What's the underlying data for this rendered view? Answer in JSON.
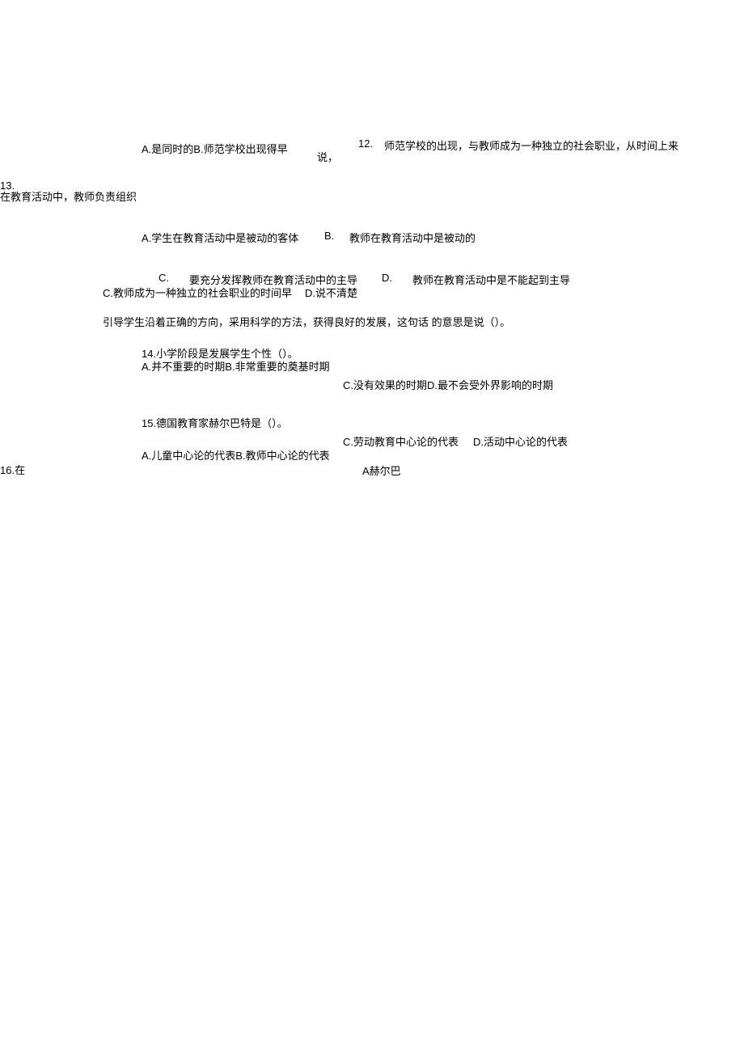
{
  "t1": "A.是同时的B.师范学校出现得早",
  "t2": "说，",
  "t3": "12.",
  "t4": "师范学校的出现，与教师成为一种独立的社会职业，从时间上来",
  "t5": "13.",
  "t6": "在教育活动中，教师负责组织",
  "t7": "A.学生在教育活动中是被动的客体",
  "t8": "B.",
  "t9": "教师在教育活动中是被动的",
  "t10": "C.",
  "t11": "要充分发挥教师在教育活动中的主导",
  "t12": "D.",
  "t13": "教师在教育活动中是不能起到主导",
  "t14": "C.教师成为一种独立的社会职业的时间早",
  "t15": "D.说不清楚",
  "t16": "引导学生沿着正确的方向，采用科学的方法，获得良好的发展，这句话 的意思是说（）。",
  "t17": "14.小学阶段是发展学生个性（）。",
  "t18": "A.并不重要的时期B.非常重要的奠基时期",
  "t19": "C.没有效果的时期D.最不会受外界影响的时期",
  "t20": "15.德国教育家赫尔巴特是（）。",
  "t21": "C.劳动教育中心论的代表",
  "t22": "D.活动中心论的代表",
  "t23": "A.儿童中心论的代表B.教师中心论的代表",
  "t24": "A赫尔巴",
  "t25": "16.在",
  "t26": ""
}
